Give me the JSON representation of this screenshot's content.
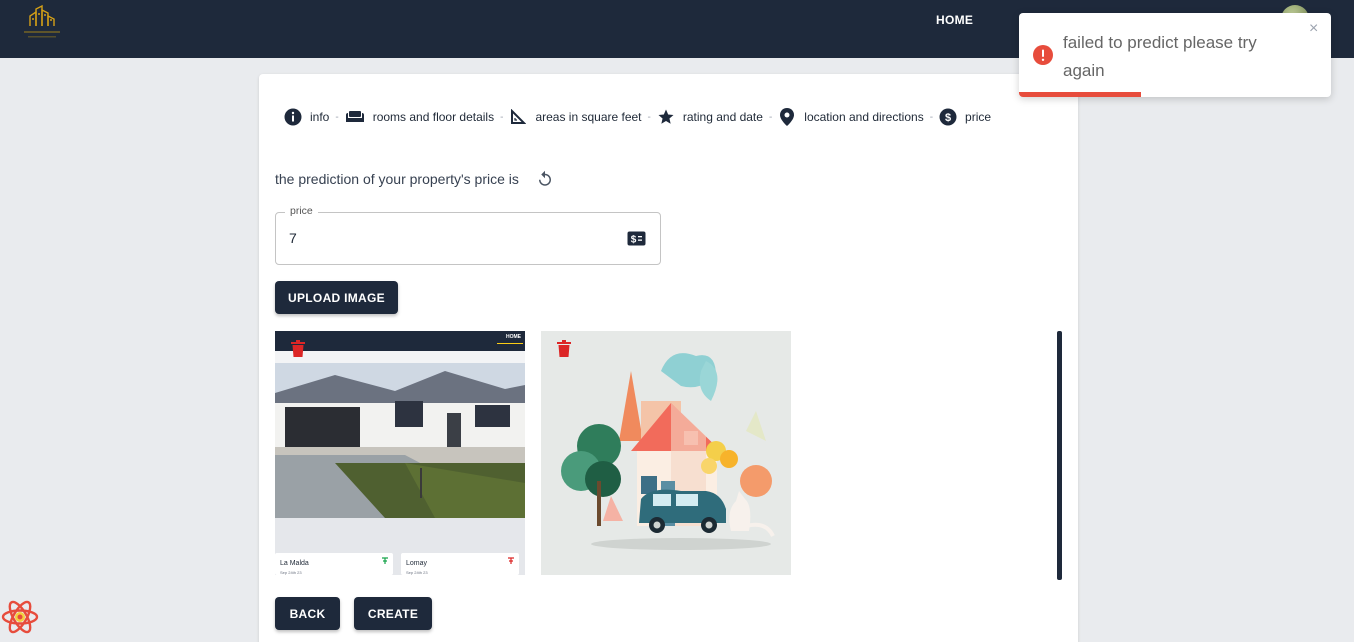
{
  "app": {
    "nav_home": "HOME"
  },
  "stepper": {
    "steps": [
      {
        "label": "info",
        "icon": "info-icon"
      },
      {
        "label": "rooms and floor details",
        "icon": "sofa-icon"
      },
      {
        "label": "areas in square feet",
        "icon": "set-square-icon"
      },
      {
        "label": "rating and date",
        "icon": "star-icon"
      },
      {
        "label": "location and directions",
        "icon": "location-pin-icon"
      },
      {
        "label": "price",
        "icon": "dollar-circle-icon"
      }
    ]
  },
  "prediction": {
    "text": "the prediction of your property's price is"
  },
  "price_field": {
    "label": "price",
    "value": "7"
  },
  "buttons": {
    "upload": "UPLOAD IMAGE",
    "back": "BACK",
    "create": "CREATE"
  },
  "screenshot_thumb": {
    "nav_home": "HOME",
    "card1_title": "La Malda",
    "card1_sub": "Sep 24th 23",
    "card2_title": "Lomay",
    "card2_sub": "Sep 24th 23"
  },
  "toast": {
    "message": "failed to predict please try again",
    "close": "×",
    "progress": 0.39
  },
  "colors": {
    "navbar": "#1e293b",
    "accent": "#1e293b",
    "error": "#e74c3c",
    "delete": "#dc2626"
  }
}
